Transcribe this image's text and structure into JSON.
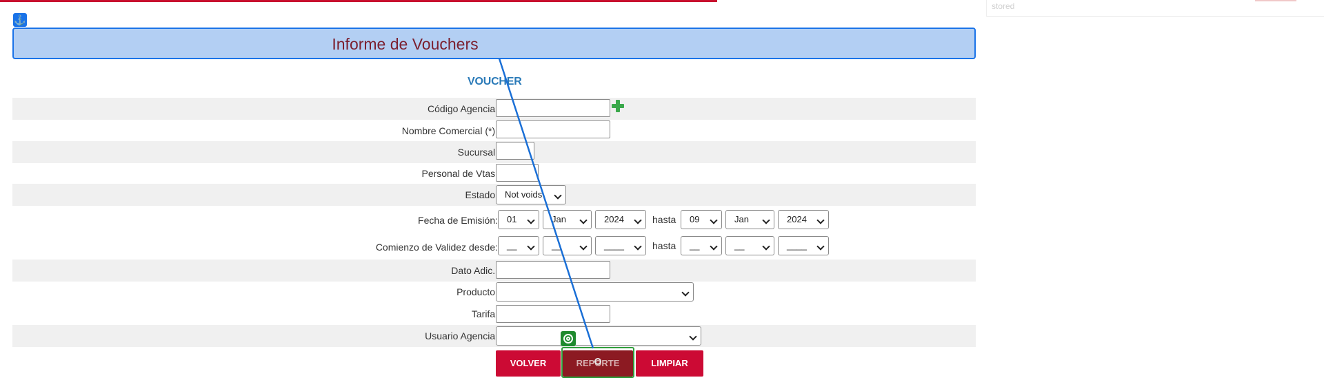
{
  "header": {
    "title": "Informe de Vouchers",
    "anchor_icon": "anchor-icon"
  },
  "ghost": {
    "text": "stored"
  },
  "section": {
    "title": "VOUCHER"
  },
  "form": {
    "codigo_agencia": {
      "label": "Código Agencia:",
      "value": ""
    },
    "nombre_comercial": {
      "label": "Nombre Comercial (*):",
      "value": ""
    },
    "sucursal": {
      "label": "Sucursal:",
      "value": ""
    },
    "personal_vtas": {
      "label": "Personal de Vtas:",
      "value": ""
    },
    "estado": {
      "label": "Estado:",
      "value": "Not voids"
    },
    "fecha_emision": {
      "label": "Fecha de Emisión:",
      "from_day": "01",
      "from_month": "Jan",
      "from_year": "2024",
      "hasta": "hasta",
      "to_day": "09",
      "to_month": "Jan",
      "to_year": "2024"
    },
    "comienzo_validez": {
      "label": "Comienzo de Validez desde:",
      "from_day": "__",
      "from_month": "__",
      "from_year": "____",
      "hasta": "hasta",
      "to_day": "__",
      "to_month": "__",
      "to_year": "____"
    },
    "dato_adic": {
      "label": "Dato Adic.:",
      "value": ""
    },
    "producto": {
      "label": "Producto:",
      "value": ""
    },
    "tarifa": {
      "label": "Tarifa:",
      "value": ""
    },
    "usuario_agencia": {
      "label": "Usuario Agencia:",
      "value": ""
    }
  },
  "buttons": {
    "volver": "VOLVER",
    "reporte": "REPORTE",
    "limpiar": "LIMPIAR"
  },
  "colors": {
    "accent_red": "#cc0a34",
    "title_bar": "#b3cff3",
    "highlight_blue": "#1a73e8",
    "highlight_green": "#2f9e3c"
  }
}
